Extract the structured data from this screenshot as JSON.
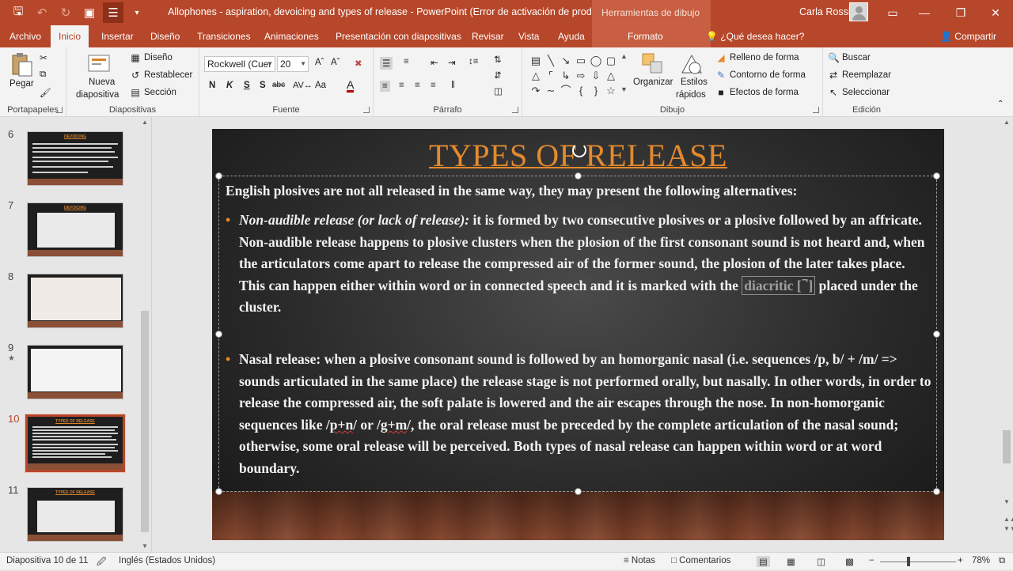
{
  "window": {
    "title": "Allophones - aspiration, devoicing and types of release  -  PowerPoint (Error de activación de productos)",
    "contextual_group": "Herramientas de dibujo",
    "user": "Carla Rossi"
  },
  "tabs": [
    "Archivo",
    "Inicio",
    "Insertar",
    "Diseño",
    "Transiciones",
    "Animaciones",
    "Presentación con diapositivas",
    "Revisar",
    "Vista",
    "Ayuda",
    "Formato"
  ],
  "tell_me": "¿Qué desea hacer?",
  "share": "Compartir",
  "ribbon": {
    "portapapeles": {
      "label": "Portapapeles",
      "paste": "Pegar"
    },
    "diapositivas": {
      "label": "Diapositivas",
      "new_slide_1": "Nueva",
      "new_slide_2": "diapositiva",
      "layout": "Diseño",
      "reset": "Restablecer",
      "section": "Sección"
    },
    "fuente": {
      "label": "Fuente",
      "font": "Rockwell (Cuer",
      "size": "20",
      "bold": "N",
      "italic": "K",
      "underline": "S",
      "strike": "S",
      "spacing": "abc",
      "case": "Aa"
    },
    "parrafo": {
      "label": "Párrafo"
    },
    "dibujo": {
      "label": "Dibujo",
      "arrange": "Organizar",
      "quick_styles_1": "Estilos",
      "quick_styles_2": "rápidos",
      "fill": "Relleno de forma",
      "outline": "Contorno de forma",
      "effects": "Efectos de forma"
    },
    "edicion": {
      "label": "Edición",
      "find": "Buscar",
      "replace": "Reemplazar",
      "select": "Seleccionar"
    }
  },
  "thumbnails": [
    {
      "num": "6",
      "title": "DEVOICING"
    },
    {
      "num": "7",
      "title": "DEVOICING"
    },
    {
      "num": "8",
      "title": ""
    },
    {
      "num": "9",
      "title": "",
      "star": "★"
    },
    {
      "num": "10",
      "title": "TYPES OF RELEASE"
    },
    {
      "num": "11",
      "title": "TYPES OF RELEASE"
    }
  ],
  "slide": {
    "title": "TYPES OF RELEASE",
    "intro": "English plosives are not all released in the same way, they may present the following alternatives:",
    "bullet1": {
      "lead": "Non-audible release (or lack of release):",
      "text_a": " it is formed by two consecutive plosives or a plosive followed by an affricate. Non-audible release happens to plosive clusters when the plosion of the first consonant sound is not  heard and, when the articulators come apart to release the compressed air of the former sound, the plosion of the later takes place. This can happen either within word or in connected speech and it is marked with the ",
      "diacritic": "diacritic [ ̚ ]",
      "text_b": " placed under the cluster."
    },
    "bullet2": {
      "text_a": "Nasal release: when a plosive consonant sound is followed by an homorganic nasal (i.e. sequences /p, b/ + /m/ => sounds articulated in the same place) the release stage is not performed orally, but nasally. In other words, in order to release the compressed air, the soft palate is lowered and the air escapes through the nose. In non-homorganic sequences like /",
      "pn": "p+n",
      "mid": "/ or /",
      "gm": "g+m",
      "text_b": "/, the oral release must be preceded by the complete articulation of the nasal sound; otherwise, some oral release will be perceived. Both types of nasal release can happen within word or at word boundary."
    }
  },
  "status": {
    "slide_of": "Diapositiva 10 de 11",
    "language": "Inglés (Estados Unidos)",
    "notes": "Notas",
    "comments": "Comentarios",
    "zoom": "78%"
  },
  "colors": {
    "accent": "#b7472a",
    "title_orange": "#e38a2e"
  }
}
